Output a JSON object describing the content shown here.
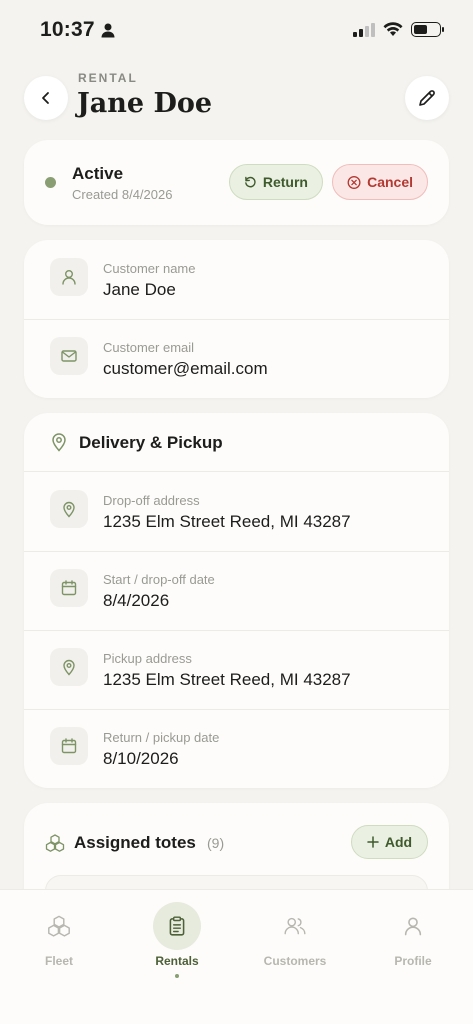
{
  "status_bar": {
    "time": "10:37"
  },
  "header": {
    "eyebrow": "RENTAL",
    "title": "Jane Doe"
  },
  "status_card": {
    "status": "Active",
    "created": "Created 8/4/2026",
    "return_label": "Return",
    "cancel_label": "Cancel",
    "status_color": "#8a9e74"
  },
  "customer": {
    "name_label": "Customer name",
    "name_value": "Jane Doe",
    "email_label": "Customer email",
    "email_value": "customer@email.com"
  },
  "delivery": {
    "title": "Delivery & Pickup",
    "dropoff_label": "Drop-off address",
    "dropoff_value": "1235 Elm Street Reed, MI 43287",
    "start_label": "Start / drop-off date",
    "start_value": "8/4/2026",
    "pickup_label": "Pickup address",
    "pickup_value": "1235 Elm Street Reed, MI 43287",
    "return_label": "Return / pickup date",
    "return_value": "8/10/2026"
  },
  "totes": {
    "title": "Assigned totes",
    "count": "(9)",
    "add_label": "Add"
  },
  "tabs": [
    {
      "label": "Fleet",
      "icon": "boxes-icon"
    },
    {
      "label": "Rentals",
      "icon": "clipboard-icon",
      "active": true
    },
    {
      "label": "Customers",
      "icon": "users-icon"
    },
    {
      "label": "Profile",
      "icon": "user-icon"
    }
  ],
  "colors": {
    "accent": "#8a9e74",
    "accent_bg": "#eaf0e2",
    "danger": "#b33a33",
    "danger_bg": "#fbe7e6"
  }
}
